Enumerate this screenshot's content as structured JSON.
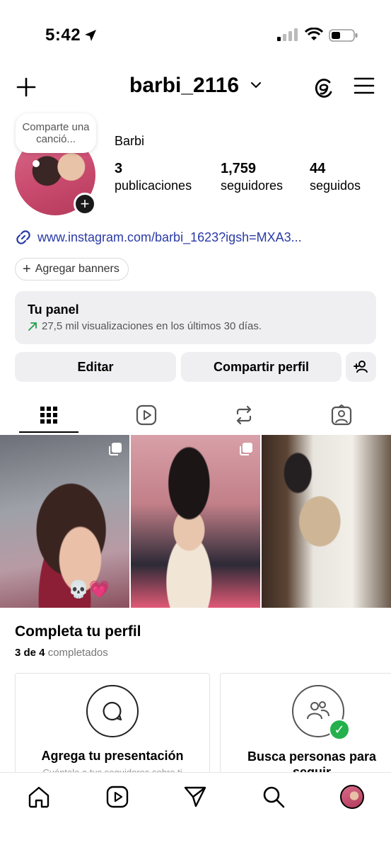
{
  "status_bar": {
    "time": "5:42"
  },
  "header": {
    "username": "barbi_2116"
  },
  "profile": {
    "note_bubble": "Comparte una canció...",
    "display_name": "Barbi",
    "stats": [
      {
        "value": "3",
        "label": "publicaciones"
      },
      {
        "value": "1,759",
        "label": "seguidores"
      },
      {
        "value": "44",
        "label": "seguidos"
      }
    ],
    "link": "www.instagram.com/barbi_1623?igsh=MXA3...",
    "banner_button": "Agregar banners",
    "add_icon": "+"
  },
  "panel": {
    "title": "Tu panel",
    "subtitle": "27,5 mil visualizaciones en los últimos 30 días."
  },
  "actions": {
    "edit": "Editar",
    "share": "Compartir perfil"
  },
  "tabs": [
    "grid-icon",
    "reels-icon",
    "reposts-icon",
    "tagged-icon"
  ],
  "posts": [
    {
      "emoji": "💀💗"
    },
    {
      "emoji": ""
    },
    {
      "emoji": ""
    }
  ],
  "complete_profile": {
    "title": "Completa tu perfil",
    "count": "3 de 4",
    "count_label": "completados",
    "cards": [
      {
        "title": "Agrega tu presentación",
        "desc": "Cuéntale a tus seguidores sobre ti"
      },
      {
        "title": "Busca personas para seguir",
        "desc": ""
      }
    ]
  },
  "bottom_nav": [
    "home-icon",
    "reels-icon",
    "send-icon",
    "search-icon",
    "profile-avatar"
  ],
  "colors": {
    "link": "#2a3aa6",
    "accent_green": "#24b14c",
    "panel_bg": "#efeff1"
  }
}
